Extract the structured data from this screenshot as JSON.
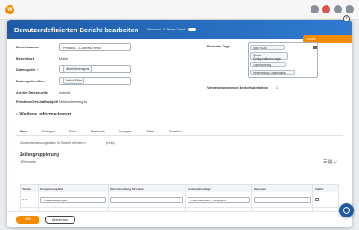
{
  "modal": {
    "title": "Benutzerdefinierten Bericht bearbeiten",
    "subtitle": "Personal - 3 Jahres-Trend",
    "close_glyph": "×"
  },
  "form": {
    "berichtsname_label": "Berichtsname",
    "berichtsname_value": "Personal - 3-Jahres-Trend",
    "berichtsart_label": "Berichtsart",
    "berichtsart_value": "Matrix",
    "quelle_label": "Datenquelle",
    "quelle_value": "Mitarbeiterereignis",
    "filter_label": "Datenquellenfilter",
    "filter_value": "Default Filter",
    "datenquelle_art_label": "Art der Datenquelle",
    "datenquelle_art_value": "Indirekt",
    "obj_label": "Primäres Geschäftsobjekt",
    "obj_value": "Mitarbeiterereignis",
    "tags_label": "Berichts-Tags",
    "tags": [
      "SBU HCM",
      "Quelle: Konfigurationsvorlage",
      "Top Reporting",
      "Verwendung: Dashboards"
    ],
    "verwendung_label": "Verwendungen von Berichtsdefinition",
    "verwendung_value": "1",
    "orange_button": "Label"
  },
  "section_title": "Weitere Informationen",
  "tabs": [
    "Basis",
    "Einfügen",
    "Filter",
    "Merkmale",
    "Ausgabe",
    "Teilen",
    "Erweitert"
  ],
  "table": {
    "zusammen_label": "Zusammenfassungsdaten für Bericht definieren",
    "zusammen_value": "(Liest)",
    "heading": "Zeilengruppierung",
    "count": "4 Elemente",
    "headers": [
      "Verlauf",
      "Gruppierungsfeld",
      "Überschreibung für Label",
      "Sortierreihenfolge",
      "Optionen",
      "Inaktiv"
    ],
    "rows": [
      {
        "field": "Mitarbeiterereignis",
        "sort": "Zeitzusammen - Absteigend"
      },
      {
        "field": "Mitarbeiterereignis",
        "sort": "Zeitzusammen - Absteigend"
      }
    ]
  },
  "footer": {
    "ok": "OK",
    "cancel": "Abbrechen"
  }
}
